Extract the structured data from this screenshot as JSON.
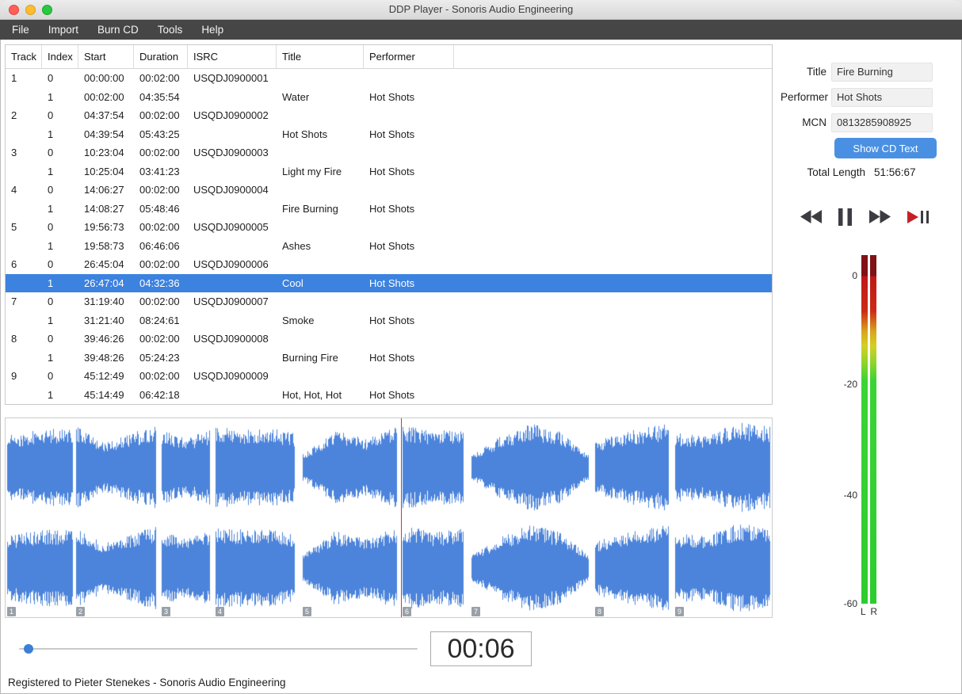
{
  "window": {
    "title": "DDP Player - Sonoris Audio Engineering"
  },
  "menu": {
    "items": [
      "File",
      "Import",
      "Burn CD",
      "Tools",
      "Help"
    ]
  },
  "table": {
    "columns": [
      "Track",
      "Index",
      "Start",
      "Duration",
      "ISRC",
      "Title",
      "Performer"
    ],
    "rows": [
      {
        "track": "1",
        "index": "0",
        "start": "00:00:00",
        "duration": "00:02:00",
        "isrc": "USQDJ0900001",
        "title": "",
        "performer": "",
        "selected": false
      },
      {
        "track": "",
        "index": "1",
        "start": "00:02:00",
        "duration": "04:35:54",
        "isrc": "",
        "title": "Water",
        "performer": "Hot Shots",
        "selected": false
      },
      {
        "track": "2",
        "index": "0",
        "start": "04:37:54",
        "duration": "00:02:00",
        "isrc": "USQDJ0900002",
        "title": "",
        "performer": "",
        "selected": false
      },
      {
        "track": "",
        "index": "1",
        "start": "04:39:54",
        "duration": "05:43:25",
        "isrc": "",
        "title": "Hot Shots",
        "performer": "Hot Shots",
        "selected": false
      },
      {
        "track": "3",
        "index": "0",
        "start": "10:23:04",
        "duration": "00:02:00",
        "isrc": "USQDJ0900003",
        "title": "",
        "performer": "",
        "selected": false
      },
      {
        "track": "",
        "index": "1",
        "start": "10:25:04",
        "duration": "03:41:23",
        "isrc": "",
        "title": "Light my Fire",
        "performer": "Hot Shots",
        "selected": false
      },
      {
        "track": "4",
        "index": "0",
        "start": "14:06:27",
        "duration": "00:02:00",
        "isrc": "USQDJ0900004",
        "title": "",
        "performer": "",
        "selected": false
      },
      {
        "track": "",
        "index": "1",
        "start": "14:08:27",
        "duration": "05:48:46",
        "isrc": "",
        "title": "Fire Burning",
        "performer": "Hot Shots",
        "selected": false
      },
      {
        "track": "5",
        "index": "0",
        "start": "19:56:73",
        "duration": "00:02:00",
        "isrc": "USQDJ0900005",
        "title": "",
        "performer": "",
        "selected": false
      },
      {
        "track": "",
        "index": "1",
        "start": "19:58:73",
        "duration": "06:46:06",
        "isrc": "",
        "title": "Ashes",
        "performer": "Hot Shots",
        "selected": false
      },
      {
        "track": "6",
        "index": "0",
        "start": "26:45:04",
        "duration": "00:02:00",
        "isrc": "USQDJ0900006",
        "title": "",
        "performer": "",
        "selected": false
      },
      {
        "track": "",
        "index": "1",
        "start": "26:47:04",
        "duration": "04:32:36",
        "isrc": "",
        "title": "Cool",
        "performer": "Hot Shots",
        "selected": true
      },
      {
        "track": "7",
        "index": "0",
        "start": "31:19:40",
        "duration": "00:02:00",
        "isrc": "USQDJ0900007",
        "title": "",
        "performer": "",
        "selected": false
      },
      {
        "track": "",
        "index": "1",
        "start": "31:21:40",
        "duration": "08:24:61",
        "isrc": "",
        "title": "Smoke",
        "performer": "Hot Shots",
        "selected": false
      },
      {
        "track": "8",
        "index": "0",
        "start": "39:46:26",
        "duration": "00:02:00",
        "isrc": "USQDJ0900008",
        "title": "",
        "performer": "",
        "selected": false
      },
      {
        "track": "",
        "index": "1",
        "start": "39:48:26",
        "duration": "05:24:23",
        "isrc": "",
        "title": "Burning Fire",
        "performer": "Hot Shots",
        "selected": false
      },
      {
        "track": "9",
        "index": "0",
        "start": "45:12:49",
        "duration": "00:02:00",
        "isrc": "USQDJ0900009",
        "title": "",
        "performer": "",
        "selected": false
      },
      {
        "track": "",
        "index": "1",
        "start": "45:14:49",
        "duration": "06:42:18",
        "isrc": "",
        "title": "Hot, Hot, Hot",
        "performer": "Hot Shots",
        "selected": false
      }
    ]
  },
  "side_panel": {
    "fields": [
      {
        "label": "Title",
        "value": "Fire Burning"
      },
      {
        "label": "Performer",
        "value": "Hot Shots"
      },
      {
        "label": "MCN",
        "value": "0813285908925"
      }
    ],
    "show_cd_text_label": "Show CD Text",
    "total_length_label": "Total Length",
    "total_length_value": "51:56:67"
  },
  "transport": {
    "buttons": [
      {
        "name": "rewind-button",
        "icon": "rewind-icon"
      },
      {
        "name": "pause-button",
        "icon": "pause-icon"
      },
      {
        "name": "fast-forward-button",
        "icon": "fast-forward-icon"
      },
      {
        "name": "play-to-marker-button",
        "icon": "play-to-marker-icon"
      }
    ]
  },
  "meter": {
    "scale_labels": [
      "0",
      "-20",
      "-40",
      "-60"
    ],
    "channel_labels": [
      "L",
      "R"
    ]
  },
  "waveform": {
    "playhead_fraction": 0.5165,
    "segments": [
      {
        "track": "1",
        "start": 0.002,
        "end": 0.088
      },
      {
        "track": "2",
        "start": 0.0925,
        "end": 0.196
      },
      {
        "track": "3",
        "start": 0.2035,
        "end": 0.2665
      },
      {
        "track": "4",
        "start": 0.2745,
        "end": 0.3775
      },
      {
        "track": "5",
        "start": 0.3875,
        "end": 0.511
      },
      {
        "track": "6",
        "start": 0.5185,
        "end": 0.598
      },
      {
        "track": "7",
        "start": 0.608,
        "end": 0.761
      },
      {
        "track": "8",
        "start": 0.769,
        "end": 0.8655
      },
      {
        "track": "9",
        "start": 0.8735,
        "end": 0.998
      }
    ]
  },
  "slider": {
    "position": 0.012
  },
  "time_display": "00:06",
  "status_bar": "Registered to Pieter Stenekes - Sonoris Audio Engineering",
  "colors": {
    "selection": "#3c82df",
    "button": "#4a90e2",
    "waveform": "#4d84db",
    "playhead": "#e03030"
  }
}
